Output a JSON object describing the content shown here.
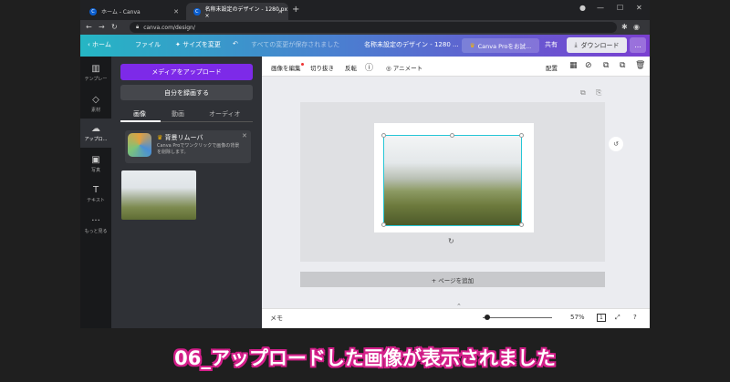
{
  "browser": {
    "tabs": [
      {
        "title": "ホーム - Canva",
        "favicon": "C"
      },
      {
        "title": "名称未設定のデザイン - 1280 px ×",
        "favicon": "C"
      }
    ],
    "url": "canva.com/design/"
  },
  "header": {
    "home": "ホーム",
    "file": "ファイル",
    "resize": "サイズを変更",
    "save_status": "すべての変更が保存されました",
    "doc_title": "名称未設定のデザイン - 1280 ...",
    "pro_button": "Canva Proをお試...",
    "share": "共有",
    "download": "ダウンロード",
    "more": "..."
  },
  "rail": [
    {
      "icon": "template-icon",
      "label": "テンプレー"
    },
    {
      "icon": "elements-icon",
      "label": "素材"
    },
    {
      "icon": "upload-icon",
      "label": "アップロ..."
    },
    {
      "icon": "photo-icon",
      "label": "写真"
    },
    {
      "icon": "text-icon",
      "label": "テキスト"
    },
    {
      "icon": "more-icon",
      "label": "もっと見る"
    }
  ],
  "panel": {
    "upload_button": "メディアをアップロード",
    "record_button": "自分を録画する",
    "tabs": [
      "画像",
      "動画",
      "オーディオ"
    ],
    "bg_remover_title": "背景リムーバ",
    "bg_remover_desc": "Canva Proでワンクリックで画像の背景を削除します。"
  },
  "toolbar": {
    "edit_image": "画像を編集",
    "crop": "切り抜き",
    "flip": "反転",
    "animate": "アニメート",
    "arrange": "配置"
  },
  "canvas": {
    "add_page": "+ ページを追加"
  },
  "footer": {
    "notes": "メモ",
    "zoom": "57%",
    "page": "1",
    "zoom_fraction": 0.07
  },
  "caption": "06_アップロードした画像が表示されました",
  "colors": {
    "upload_purple": "#7d2ae8",
    "selection_teal": "#26c6d6",
    "caption_pink": "#d41f8a"
  }
}
